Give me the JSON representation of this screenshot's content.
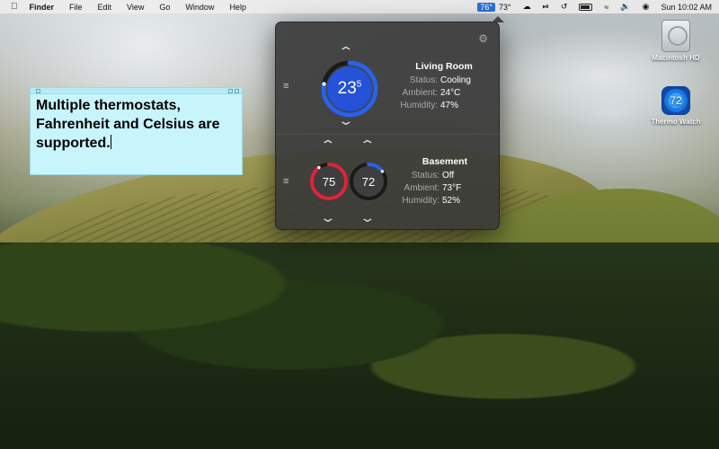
{
  "menubar": {
    "apple": "",
    "items": [
      "Finder",
      "File",
      "Edit",
      "View",
      "Go",
      "Window",
      "Help"
    ],
    "temp_indoor": "76°",
    "temp_outdoor": "73°",
    "clock": "Sun 10:02 AM"
  },
  "sticky": {
    "text": "Multiple thermostats, Fahrenheit and Celsius are supported."
  },
  "desktop": {
    "hd_label": "Macintosh HD",
    "app_label": "Thermo Watch",
    "app_icon_value": "72"
  },
  "popover": {
    "living": {
      "name": "Living Room",
      "setpoint": "23",
      "setpoint_decimal": "5",
      "status_label": "Status:",
      "status": "Cooling",
      "ambient_label": "Ambient:",
      "ambient": "24°C",
      "humidity_label": "Humidity:",
      "humidity": "47%",
      "level": 0.78
    },
    "basement": {
      "name": "Basement",
      "heat_setpoint": "75",
      "cool_setpoint": "72",
      "status_label": "Status:",
      "status": "Off",
      "ambient_label": "Ambient:",
      "ambient": "73°F",
      "humidity_label": "Humidity:",
      "humidity": "52%",
      "heat_level": 0.9,
      "cool_level": 0.15
    }
  },
  "colors": {
    "cool": "#2a62e8",
    "heat": "#e0243a",
    "highlight": "#2b6fd6"
  }
}
